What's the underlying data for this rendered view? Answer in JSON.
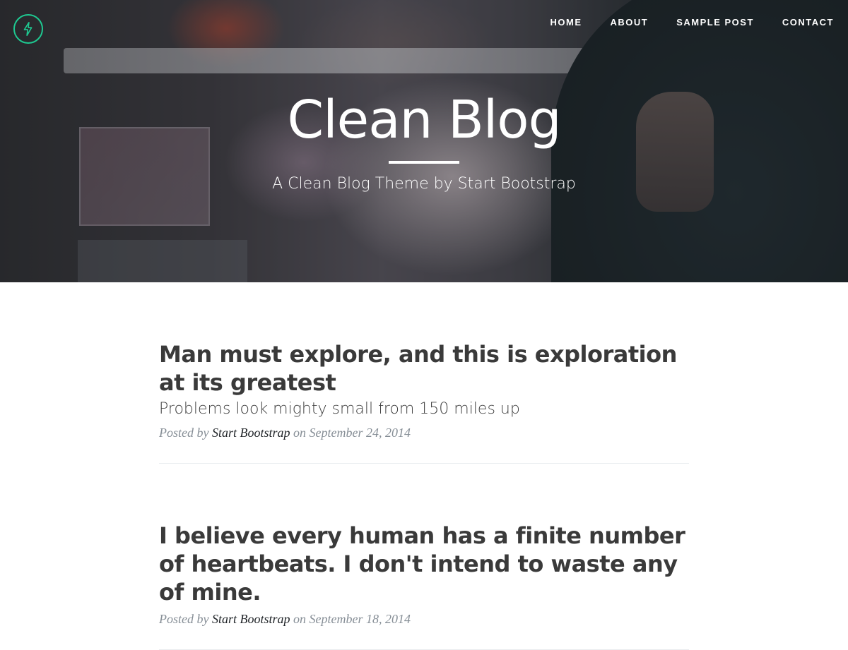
{
  "nav": {
    "brand_icon": "lightning-bolt-icon",
    "accent_color": "#1ec991",
    "links": [
      {
        "label": "HOME"
      },
      {
        "label": "ABOUT"
      },
      {
        "label": "SAMPLE POST"
      },
      {
        "label": "CONTACT"
      }
    ]
  },
  "header": {
    "title": "Clean Blog",
    "subtitle": "A Clean Blog Theme by Start Bootstrap"
  },
  "posts": [
    {
      "title": "Man must explore, and this is exploration at its greatest",
      "subtitle": "Problems look mighty small from 150 miles up",
      "meta_prefix": "Posted by",
      "author": "Start Bootstrap",
      "meta_on": "on",
      "date": "September 24, 2014"
    },
    {
      "title": "I believe every human has a finite number of heartbeats. I don't intend to waste any of mine.",
      "subtitle": "",
      "meta_prefix": "Posted by",
      "author": "Start Bootstrap",
      "meta_on": "on",
      "date": "September 18, 2014"
    }
  ]
}
